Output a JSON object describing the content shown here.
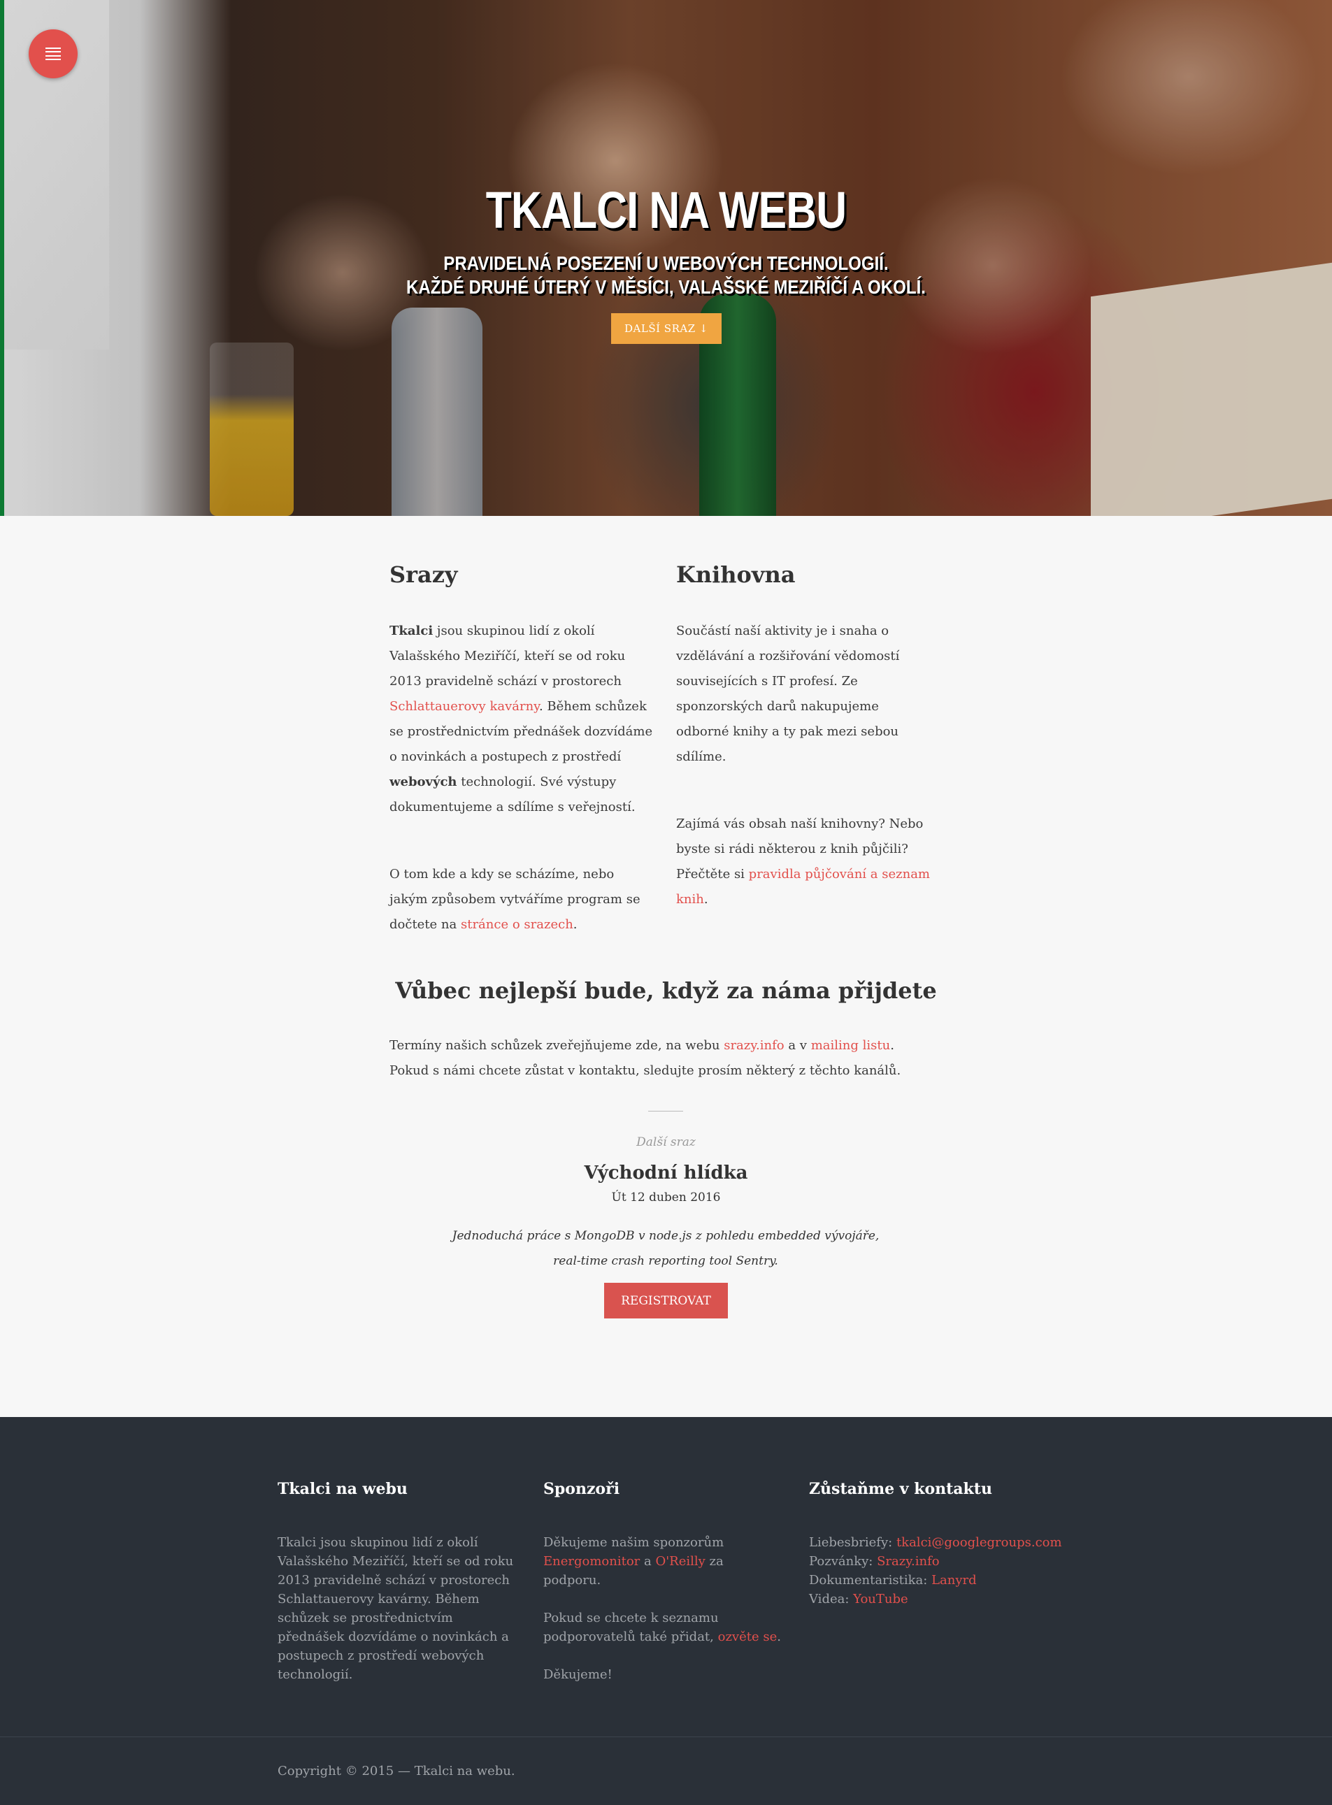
{
  "hero": {
    "title": "Tkalci na webu",
    "subtitle_line1": "Pravidelná posezení u webových technologií.",
    "subtitle_line2": "Každé druhé úterý v měsíci, Valašské Meziříčí a okolí.",
    "cta_label": "Další sraz ↓",
    "menu_icon": "menu-icon"
  },
  "srazy": {
    "heading": "Srazy",
    "p1_bold": "Tkalci",
    "p1_a": " jsou skupinou lidí z okolí Valašského Meziříčí, kteří se od roku 2013 pravidelně schází v prostorech ",
    "p1_link": "Schlattauerovy kavárny",
    "p1_b": ". Během schůzek se prostřednictvím přednášek dozvídáme o novinkách a postupech z prostředí ",
    "p1_bold2": "webových",
    "p1_c": " technologií. Své výstupy dokumentujeme a sdílíme s veřejností.",
    "p2_a": "O tom kde a kdy se scházíme, nebo jakým způsobem vytváříme program se dočtete na ",
    "p2_link": "stránce o srazech",
    "p2_b": "."
  },
  "knihovna": {
    "heading": "Knihovna",
    "p1": "Součástí naší aktivity je i snaha o vzdělávání a rozšiřování vědomostí souvisejících s IT profesí. Ze sponzorských darů nakupujeme odborné knihy a ty pak mezi sebou sdílíme.",
    "p2_a": "Zajímá vás obsah naší knihovny? Nebo byste si rádi některou z knih půjčili? Přečtěte si ",
    "p2_link": "pravidla půjčování a seznam knih",
    "p2_b": "."
  },
  "join": {
    "heading": "Vůbec nejlepší bude, když za náma přijdete",
    "intro_a": "Termíny našich schůzek zveřejňujeme zde, na webu ",
    "intro_link1": "srazy.info",
    "intro_b": " a v ",
    "intro_link2": "mailing listu",
    "intro_c": ". Pokud s námi chcete zůstat v kontaktu, sledujte prosím některý z těchto kanálů."
  },
  "next_meetup": {
    "label": "Další sraz",
    "title": "Východní hlídka",
    "date": "Út 12 duben 2016",
    "description": "Jednoduchá práce s MongoDB v node.js z pohledu embedded vývojáře, real-time crash reporting tool Sentry.",
    "register_label": "Registrovat"
  },
  "footer": {
    "about_heading": "Tkalci na webu",
    "about_text": "Tkalci jsou skupinou lidí z okolí Valašského Meziříčí, kteří se od roku 2013 pravidelně schází v prostorech Schlattauerovy kavárny. Během schůzek se prostřednictvím přednášek dozvídáme o novinkách a postupech z prostředí webových technologií.",
    "sponsors_heading": "Sponzoři",
    "sponsors_a": "Děkujeme našim sponzorům ",
    "sponsor1": "Energomonitor",
    "sponsors_b": " a ",
    "sponsor2": "O'Reilly",
    "sponsors_c": " za podporu.",
    "sponsors_p2_a": "Pokud se chcete k seznamu podporovatelů také přidat, ",
    "sponsors_p2_link": "ozvěte se",
    "sponsors_p2_b": ".",
    "sponsors_thanks": "Děkujeme!",
    "contact_heading": "Zůstaňme v kontaktu",
    "contact": [
      {
        "label": "Liebesbriefy: ",
        "value": "tkalci@googlegroups.com"
      },
      {
        "label": "Pozvánky: ",
        "value": "Srazy.info"
      },
      {
        "label": "Dokumentaristika: ",
        "value": "Lanyrd"
      },
      {
        "label": "Videa: ",
        "value": "YouTube"
      }
    ],
    "copyright": "Copyright © 2015 — Tkalci na webu."
  },
  "colors": {
    "accent": "#e2504c",
    "cta": "#f0a541",
    "footer_bg": "#2a3038",
    "page_bg": "#f7f7f7"
  }
}
